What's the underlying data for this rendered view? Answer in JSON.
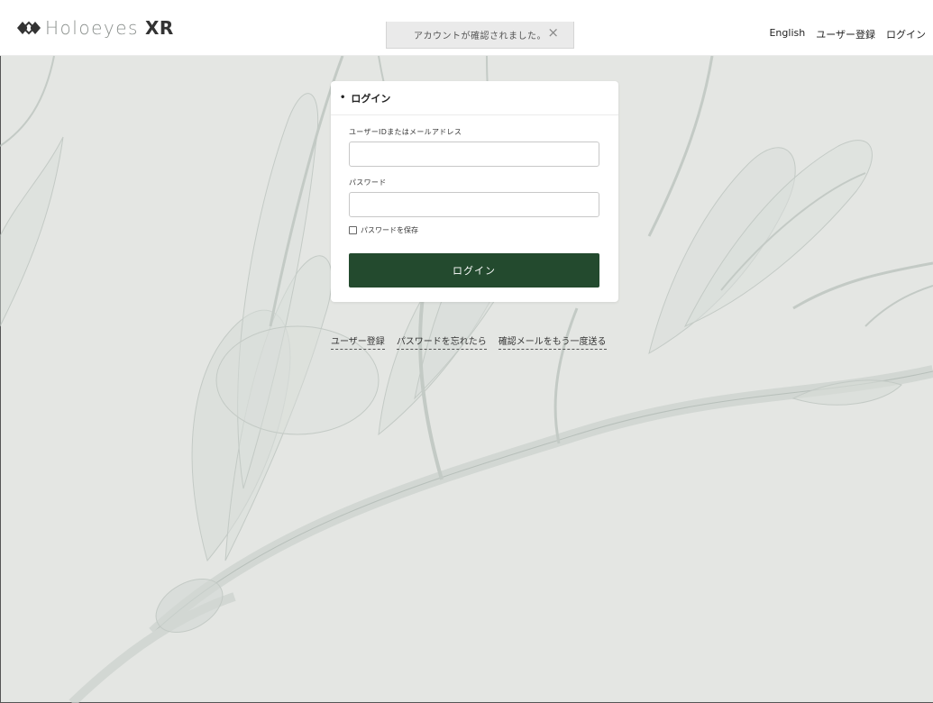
{
  "header": {
    "logo_light": "Holoeyes",
    "logo_bold": "XR",
    "nav": {
      "english": "English",
      "register": "ユーザー登録",
      "login": "ログイン"
    }
  },
  "toast": {
    "message": "アカウントが確認されました。",
    "close": "×"
  },
  "login_card": {
    "title": "ログイン",
    "bullet": "•",
    "user_label": "ユーザーIDまたはメールアドレス",
    "user_value": "",
    "password_label": "パスワード",
    "password_value": "",
    "remember_label": "パスワードを保存",
    "remember_checked": false,
    "submit_label": "ログイン"
  },
  "footer_links": {
    "register": "ユーザー登録",
    "forgot_password": "パスワードを忘れたら",
    "resend_confirmation": "確認メールをもう一度送る"
  },
  "colors": {
    "primary_button": "#234a2e",
    "background": "#e4e6e3",
    "flower": "#b9c1bc"
  },
  "icons": {
    "logo": "holoeyes-logo-icon",
    "close": "close-icon",
    "checkbox": "checkbox-icon"
  }
}
